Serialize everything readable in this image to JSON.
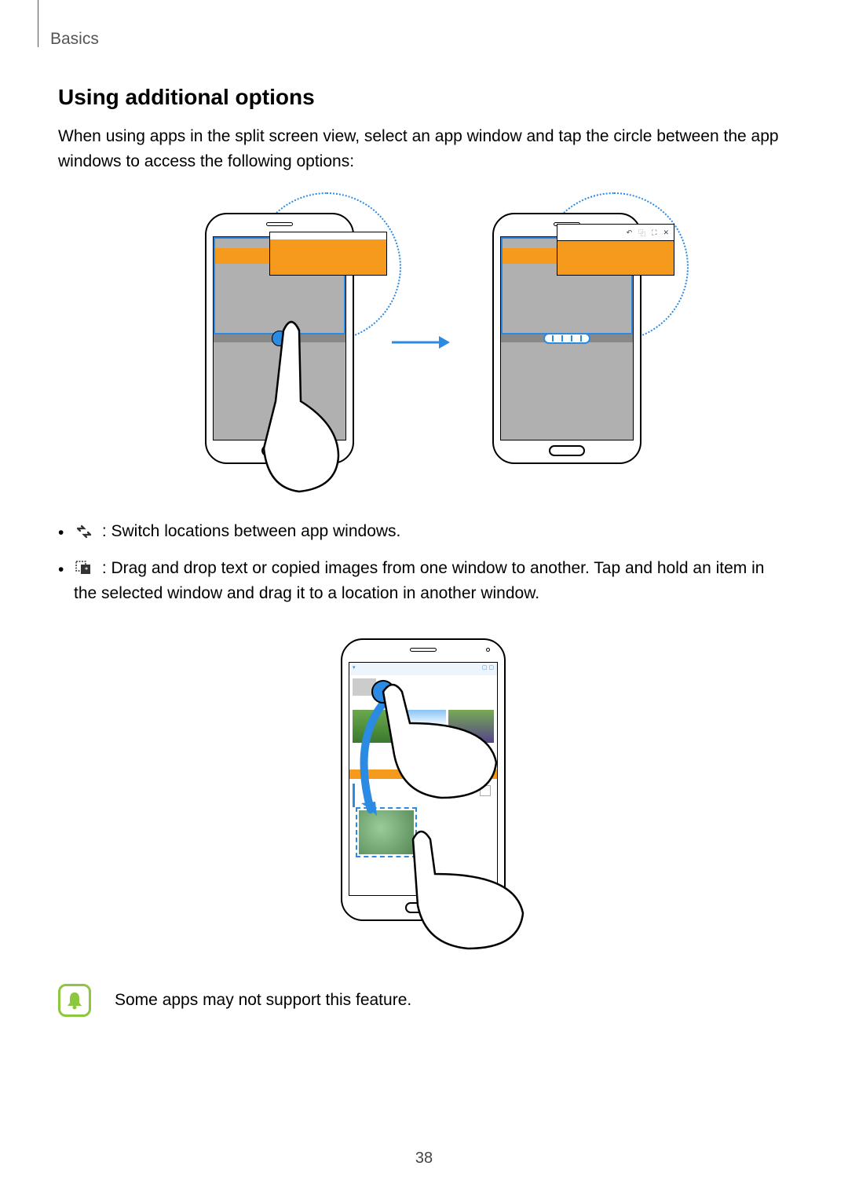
{
  "breadcrumb": "Basics",
  "section_title": "Using additional options",
  "intro": "When using apps in the split screen view, select an app window and tap the circle between the app windows to access the following options:",
  "bullets": {
    "switch": " : Switch locations between app windows.",
    "drag": " : Drag and drop text or copied images from one window to another. Tap and hold an item in the selected window and drag it to a location in another window."
  },
  "note": "Some apps may not support this feature.",
  "page_number": "38",
  "icons": {
    "switch_name": "switch-windows-icon",
    "drag_name": "drag-drop-icon",
    "bell_name": "note-bell-icon"
  },
  "toolbar_icons": [
    "↶",
    "⿻",
    "⛶",
    "✕"
  ]
}
